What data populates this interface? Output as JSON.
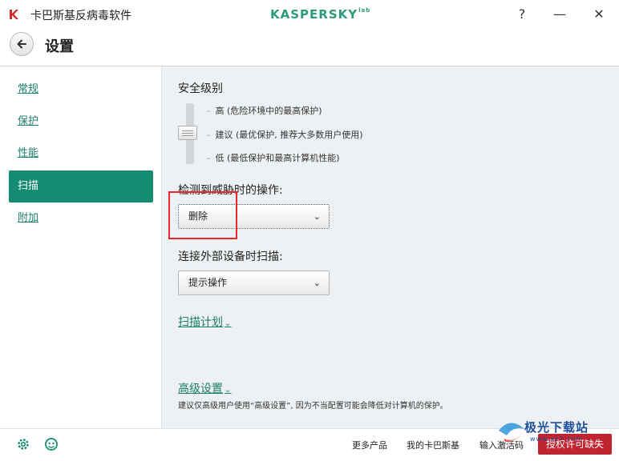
{
  "window": {
    "title": "卡巴斯基反病毒软件",
    "brand": "KASPERSKY",
    "brand_suffix": "lab",
    "help_label": "?",
    "minimize_label": "—",
    "close_label": "✕"
  },
  "header": {
    "title": "设置"
  },
  "sidebar": {
    "items": [
      {
        "label": "常规",
        "active": false
      },
      {
        "label": "保护",
        "active": false
      },
      {
        "label": "性能",
        "active": false
      },
      {
        "label": "扫描",
        "active": true
      },
      {
        "label": "附加",
        "active": false
      }
    ]
  },
  "main": {
    "security_level": {
      "title": "安全级别",
      "levels": [
        {
          "label": "高 (危险环境中的最高保护)"
        },
        {
          "label": "建议 (最优保护, 推荐大多数用户使用)"
        },
        {
          "label": "低 (最低保护和最高计算机性能)"
        }
      ],
      "selected_level": "建议"
    },
    "threat_action": {
      "label": "检测到威胁时的操作:",
      "value": "删除"
    },
    "external_device": {
      "label": "连接外部设备时扫描:",
      "value": "提示操作"
    },
    "scan_schedule_link": "扫描计划",
    "advanced_link": "高级设置",
    "advanced_note": "建议仅高级用户使用“高级设置”, 因为不当配置可能会降低对计算机的保护。"
  },
  "footer": {
    "links": [
      "更多产品",
      "我的卡巴斯基",
      "输入激活码"
    ],
    "license_button": "授权许可缺失",
    "watermark": "极光下载站",
    "watermark_sub": "www.xz7.com"
  },
  "colors": {
    "accent": "#148c72",
    "brand": "#2c9a7b",
    "highlight": "#e8282a",
    "license": "#c0242f"
  }
}
